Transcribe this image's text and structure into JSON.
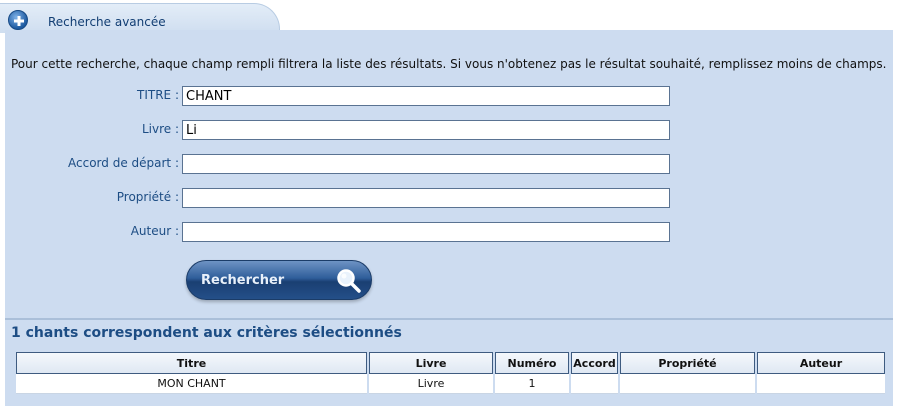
{
  "tab": {
    "title": "Recherche avancée",
    "icon": "plus-circle-icon"
  },
  "intro_text": "Pour cette recherche, chaque champ rempli filtrera la liste des résultats. Si vous n'obtenez pas le résultat souhaité, remplissez moins de champs.",
  "fields": {
    "titre": {
      "label": "TITRE :",
      "value": "CHANT"
    },
    "livre": {
      "label": "Livre :",
      "value": "Li"
    },
    "accord": {
      "label": "Accord de départ :",
      "value": ""
    },
    "propriete": {
      "label": "Propriété :",
      "value": ""
    },
    "auteur": {
      "label": "Auteur :",
      "value": ""
    }
  },
  "search_button": {
    "label": "Rechercher",
    "icon": "magnifier-icon"
  },
  "results": {
    "summary": "1 chants correspondent aux critères sélectionnés",
    "columns": [
      "Titre",
      "Livre",
      "Numéro",
      "Accord",
      "Propriété",
      "Auteur"
    ],
    "rows": [
      [
        "MON CHANT",
        "Livre",
        "1",
        "",
        "",
        ""
      ]
    ]
  },
  "colors": {
    "panel": "#cddcf0",
    "label": "#1d4d84",
    "button": "#2f5e9a"
  }
}
